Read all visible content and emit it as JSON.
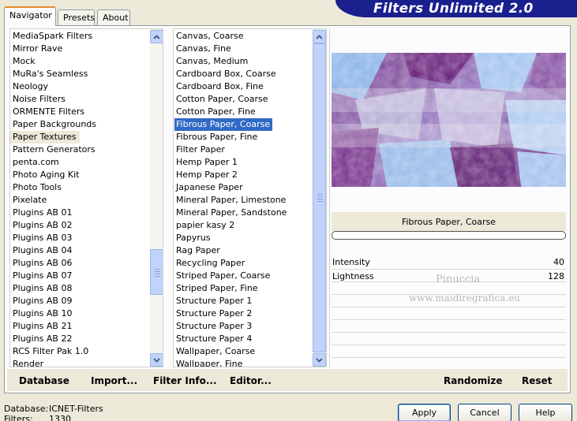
{
  "banner": {
    "title": "Filters Unlimited 2.0"
  },
  "tabs": [
    {
      "label": "Navigator"
    },
    {
      "label": "Presets"
    },
    {
      "label": "About"
    }
  ],
  "categories": {
    "items": [
      "MediaSpark Filters",
      "Mirror Rave",
      "Mock",
      "MuRa's Seamless",
      "Neology",
      "Noise Filters",
      "ORMENTE Filters",
      "Paper Backgrounds",
      "Paper Textures",
      "Pattern Generators",
      "penta.com",
      "Photo Aging Kit",
      "Photo Tools",
      "Pixelate",
      "Plugins AB 01",
      "Plugins AB 02",
      "Plugins AB 03",
      "Plugins AB 04",
      "Plugins AB 06",
      "Plugins AB 07",
      "Plugins AB 08",
      "Plugins AB 09",
      "Plugins AB 10",
      "Plugins AB 21",
      "Plugins AB 22",
      "RCS Filter Pak 1.0",
      "Render"
    ],
    "selected": "Paper Textures"
  },
  "filters": {
    "items": [
      "Canvas, Coarse",
      "Canvas, Fine",
      "Canvas, Medium",
      "Cardboard Box, Coarse",
      "Cardboard Box, Fine",
      "Cotton Paper, Coarse",
      "Cotton Paper, Fine",
      "Fibrous Paper, Coarse",
      "Fibrous Paper, Fine",
      "Filter Paper",
      "Hemp Paper 1",
      "Hemp Paper 2",
      "Japanese Paper",
      "Mineral Paper, Limestone",
      "Mineral Paper, Sandstone",
      "papier kasy 2",
      "Papyrus",
      "Rag Paper",
      "Recycling Paper",
      "Striped Paper, Coarse",
      "Striped Paper, Fine",
      "Structure Paper 1",
      "Structure Paper 2",
      "Structure Paper 3",
      "Structure Paper 4",
      "Wallpaper, Coarse",
      "Wallpaper, Fine"
    ],
    "selected": "Fibrous Paper, Coarse"
  },
  "preview": {
    "filter_name": "Fibrous Paper, Coarse",
    "progress": 0
  },
  "params": [
    {
      "label": "Intensity",
      "value": "40"
    },
    {
      "label": "Lightness",
      "value": "128"
    }
  ],
  "watermark": {
    "line1": "Pinuccia",
    "line2": "www.maidiregrafica.eu"
  },
  "links": {
    "database": "Database",
    "import": "Import...",
    "filter_info": "Filter Info...",
    "editor": "Editor..."
  },
  "actions": {
    "randomize": "Randomize",
    "reset": "Reset"
  },
  "status": {
    "database_label": "Database:",
    "database_value": "ICNET-Filters",
    "filters_label": "Filters:",
    "filters_value": "1330"
  },
  "buttons": {
    "apply": "Apply",
    "cancel": "Cancel",
    "help": "Help"
  }
}
